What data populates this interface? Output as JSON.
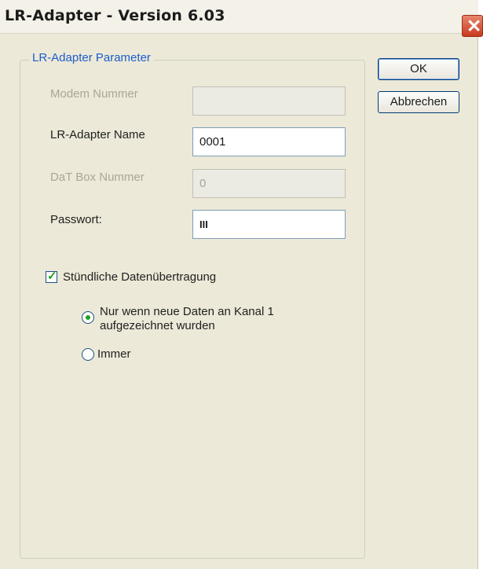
{
  "window": {
    "title": "LR-Adapter - Version 6.03",
    "close_glyph": "✕"
  },
  "group": {
    "title": "LR-Adapter Parameter"
  },
  "fields": {
    "modem_number": {
      "label": "Modem Nummer",
      "value": ""
    },
    "adapter_name": {
      "label": "LR-Adapter Name",
      "value": "0001"
    },
    "dat_box_number": {
      "label": "DaT Box Nummer",
      "value": "0"
    },
    "password": {
      "label": "Passwort:",
      "value": "III"
    }
  },
  "hourly_transfer": {
    "label": "Stündliche Datenübertragung",
    "checked": true
  },
  "radio_options": {
    "only_new_data": {
      "line1": "Nur wenn neue Daten an Kanal 1",
      "line2": "aufgezeichnet wurden",
      "selected": true
    },
    "always": {
      "label": "Immer",
      "selected": false
    }
  },
  "buttons": {
    "ok": "OK",
    "cancel": "Abbrechen"
  },
  "colors": {
    "accent_green": "#21a121",
    "group_title_blue": "#1d5ccc",
    "dialog_bg": "#ece9d8"
  }
}
